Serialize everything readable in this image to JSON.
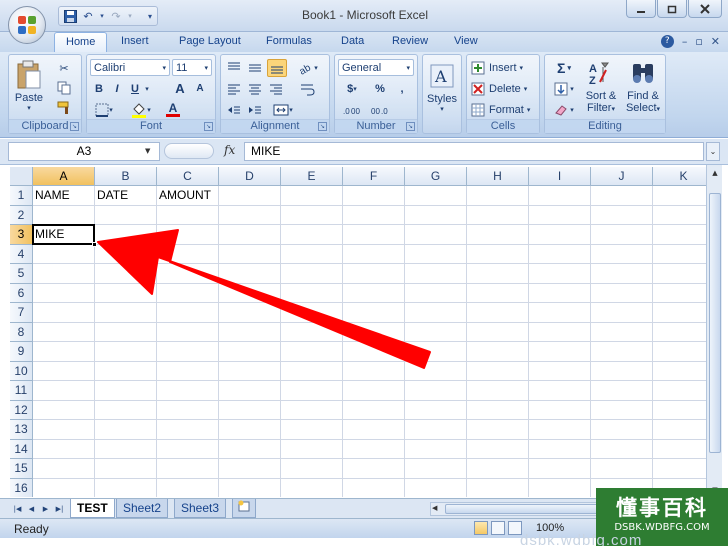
{
  "window": {
    "title": "Book1 - Microsoft Excel"
  },
  "tabs": [
    "Home",
    "Insert",
    "Page Layout",
    "Formulas",
    "Data",
    "Review",
    "View"
  ],
  "ribbon": {
    "clipboard": {
      "label": "Clipboard",
      "paste": "Paste"
    },
    "font": {
      "label": "Font",
      "family": "Calibri",
      "size": "11",
      "bold": "B",
      "italic": "I",
      "underline": "U",
      "grow": "A",
      "shrink": "A",
      "fill_letter": "A"
    },
    "alignment": {
      "label": "Alignment"
    },
    "number": {
      "label": "Number",
      "format": "General",
      "currency": "$",
      "percent": "%",
      "comma": ","
    },
    "styles": {
      "label": "Styles"
    },
    "cells": {
      "label": "Cells",
      "insert": "Insert",
      "delete": "Delete",
      "format": "Format"
    },
    "editing": {
      "label": "Editing",
      "sort_filter_1": "Sort &",
      "sort_filter_2": "Filter",
      "find_select_1": "Find &",
      "find_select_2": "Select",
      "sigma": "Σ"
    }
  },
  "formula_bar": {
    "name_box": "A3",
    "fx": "fx",
    "value": "MIKE"
  },
  "grid": {
    "columns": [
      "A",
      "B",
      "C",
      "D",
      "E",
      "F",
      "G",
      "H",
      "I",
      "J",
      "K"
    ],
    "rows": [
      "1",
      "2",
      "3",
      "4",
      "5",
      "6",
      "7",
      "8",
      "9",
      "10",
      "11",
      "12",
      "13",
      "14",
      "15",
      "16"
    ],
    "cells": {
      "A1": "NAME",
      "B1": "DATE",
      "C1": "AMOUNT",
      "A3": "MIKE"
    },
    "selected_cell": "A3"
  },
  "sheets": [
    "TEST",
    "Sheet2",
    "Sheet3"
  ],
  "status": {
    "text": "Ready",
    "zoom": "100%"
  },
  "watermark": {
    "main": "懂事百科",
    "sub": "DSBK.WDBFG.COM",
    "bottom": "dsbk.wdbfg.com"
  },
  "colors": {
    "arrow": "#ff0000",
    "selection_header": "#f1c15f",
    "watermark_bg": "#2e7d32"
  }
}
